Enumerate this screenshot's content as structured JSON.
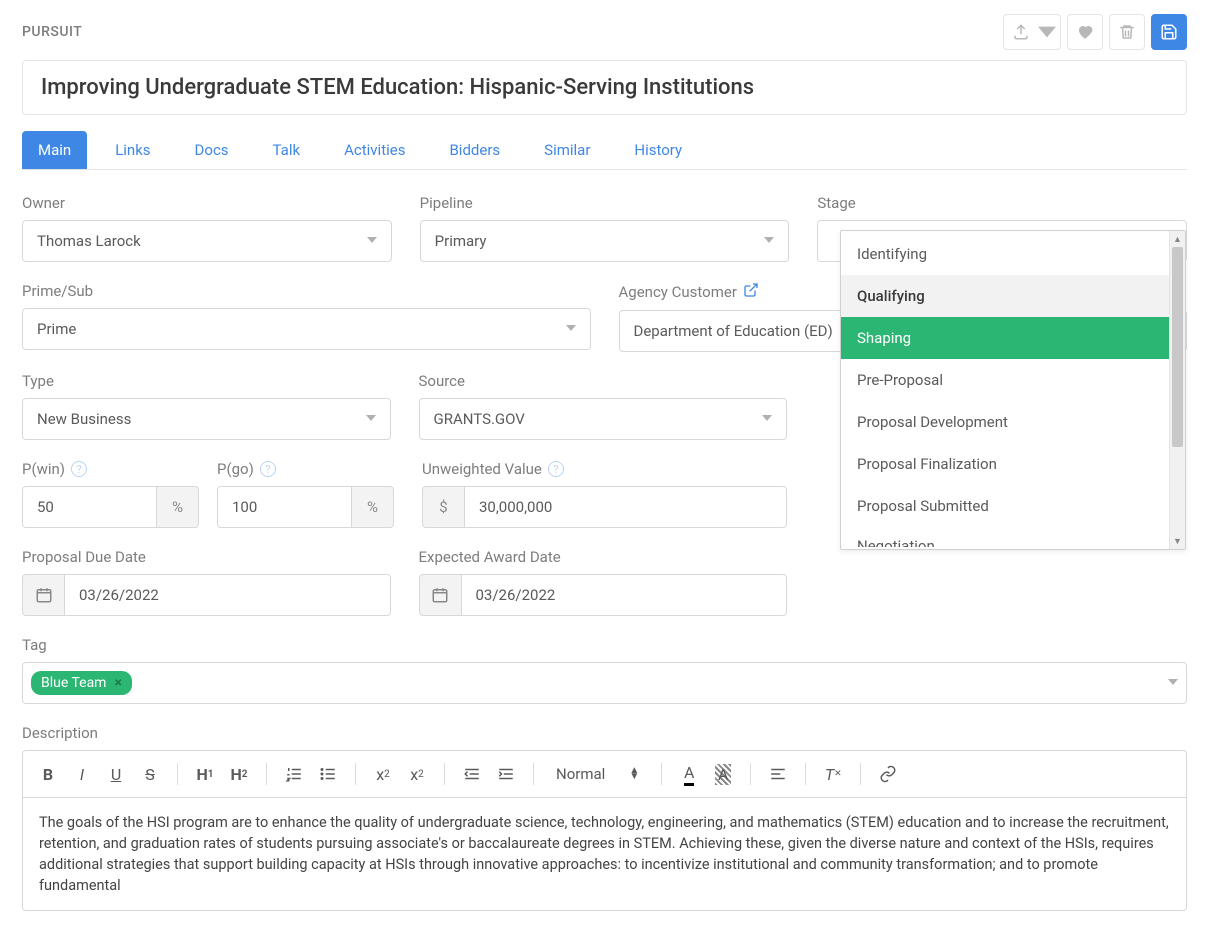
{
  "header": {
    "label": "PURSUIT",
    "title": "Improving Undergraduate STEM Education: Hispanic-Serving Institutions"
  },
  "tabs": [
    "Main",
    "Links",
    "Docs",
    "Talk",
    "Activities",
    "Bidders",
    "Similar",
    "History"
  ],
  "active_tab": 0,
  "fields": {
    "owner": {
      "label": "Owner",
      "value": "Thomas Larock"
    },
    "pipeline": {
      "label": "Pipeline",
      "value": "Primary"
    },
    "stage": {
      "label": "Stage",
      "value": ""
    },
    "prime_sub": {
      "label": "Prime/Sub",
      "value": "Prime"
    },
    "agency": {
      "label": "Agency Customer",
      "value": "Department of Education (ED)"
    },
    "type": {
      "label": "Type",
      "value": "New Business"
    },
    "source": {
      "label": "Source",
      "value": "GRANTS.GOV"
    },
    "pwin": {
      "label": "P(win)",
      "value": "50",
      "suffix": "%"
    },
    "pgo": {
      "label": "P(go)",
      "value": "100",
      "suffix": "%"
    },
    "unweighted": {
      "label": "Unweighted Value",
      "prefix": "$",
      "value": "30,000,000"
    },
    "proposal_due": {
      "label": "Proposal Due Date",
      "value": "03/26/2022"
    },
    "expected_award": {
      "label": "Expected Award Date",
      "value": "03/26/2022"
    },
    "tag": {
      "label": "Tag",
      "chips": [
        "Blue Team"
      ]
    },
    "description": {
      "label": "Description"
    }
  },
  "stage_options": [
    "Identifying",
    "Qualifying",
    "Shaping",
    "Pre-Proposal",
    "Proposal Development",
    "Proposal Finalization",
    "Proposal Submitted",
    "Negotiation"
  ],
  "stage_hover_index": 1,
  "stage_selected_index": 2,
  "editor": {
    "format_label": "Normal",
    "body": "The goals of the HSI program are to enhance the quality of undergraduate science, technology, engineering, and mathematics (STEM) education and to increase the recruitment, retention, and graduation rates of students pursuing associate's or baccalaureate degrees in STEM. Achieving these, given the diverse nature and context of the HSIs, requires additional strategies that support building capacity at HSIs through innovative approaches: to incentivize institutional and community transformation; and to promote fundamental"
  }
}
